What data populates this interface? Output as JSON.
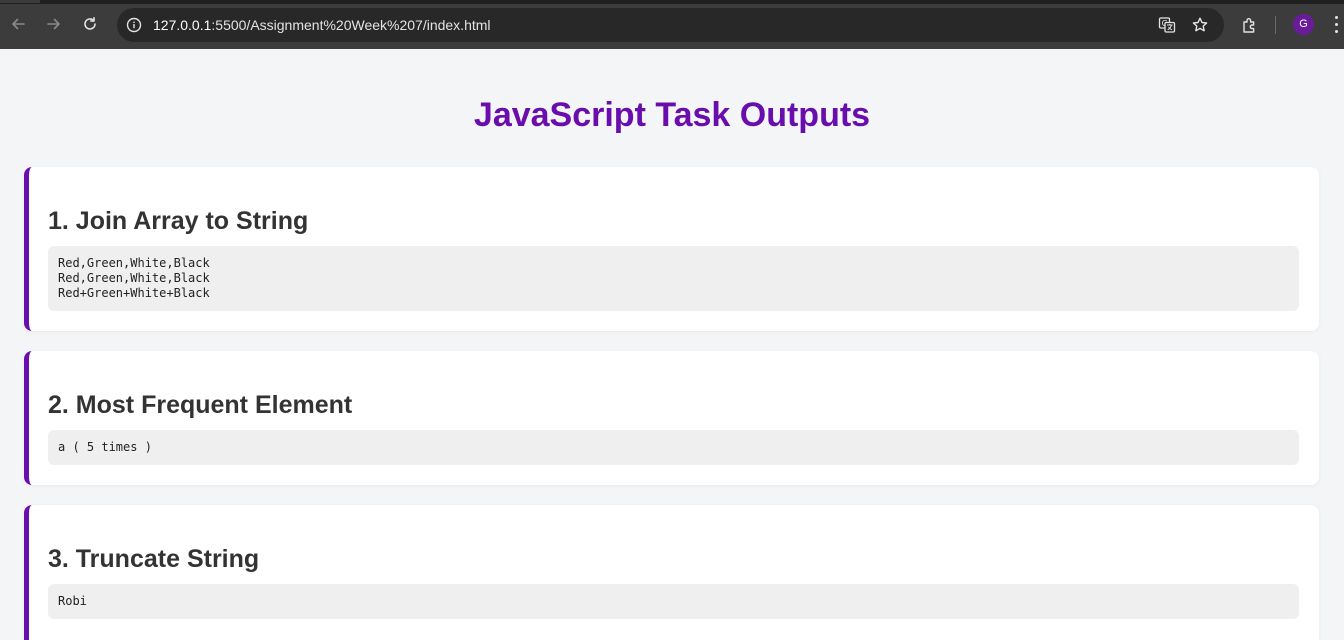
{
  "browser": {
    "url_host": "127.0.0.1",
    "url_rest": ":5500/Assignment%20Week%207/index.html",
    "profile_initial": "G",
    "icons": [
      "back-arrow-icon",
      "forward-arrow-icon",
      "reload-icon",
      "site-info-icon",
      "translate-icon",
      "bookmark-star-icon",
      "extensions-icon",
      "menu-kebab-icon"
    ]
  },
  "page": {
    "title": "JavaScript Task Outputs",
    "accent_color": "#6a0dad",
    "tasks": [
      {
        "heading": "1. Join Array to String",
        "output": [
          "Red,Green,White,Black",
          "Red,Green,White,Black",
          "Red+Green+White+Black"
        ]
      },
      {
        "heading": "2. Most Frequent Element",
        "output": [
          "a ( 5 times )"
        ]
      },
      {
        "heading": "3. Truncate String",
        "output": [
          "Robi"
        ]
      }
    ]
  }
}
